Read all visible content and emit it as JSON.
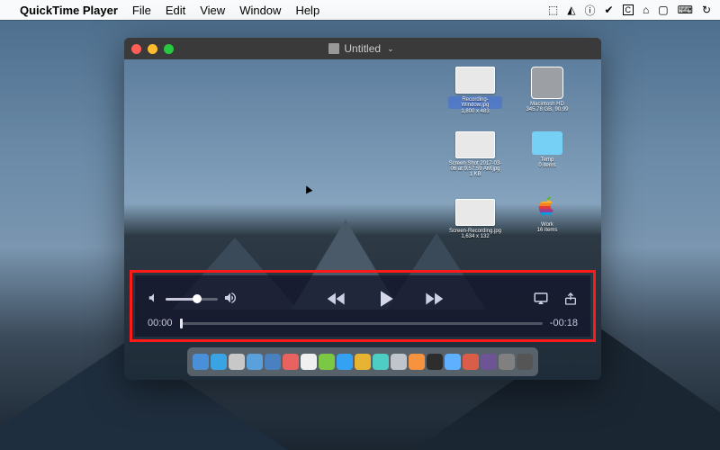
{
  "menubar": {
    "app_name": "QuickTime Player",
    "items": [
      "File",
      "Edit",
      "View",
      "Window",
      "Help"
    ]
  },
  "player": {
    "title": "Untitled",
    "desktop_icons": [
      {
        "label": "Recording-Window.jpg",
        "sub": "1,800 x 483",
        "selected": true
      },
      {
        "label": "Macintosh HD",
        "sub": "345.78 GB, 90.99"
      },
      {
        "label": "Screen Shot 2017-03-06 at 9.57.59 AM.jpg",
        "sub": "1 KB"
      },
      {
        "label": "Temp",
        "sub": "0 items"
      },
      {
        "label": "Screen-Recording.jpg",
        "sub": "1,634 x 132"
      },
      {
        "label": "Work",
        "sub": "16 items"
      }
    ],
    "controls": {
      "time_elapsed": "00:00",
      "time_remaining": "-00:18"
    }
  }
}
